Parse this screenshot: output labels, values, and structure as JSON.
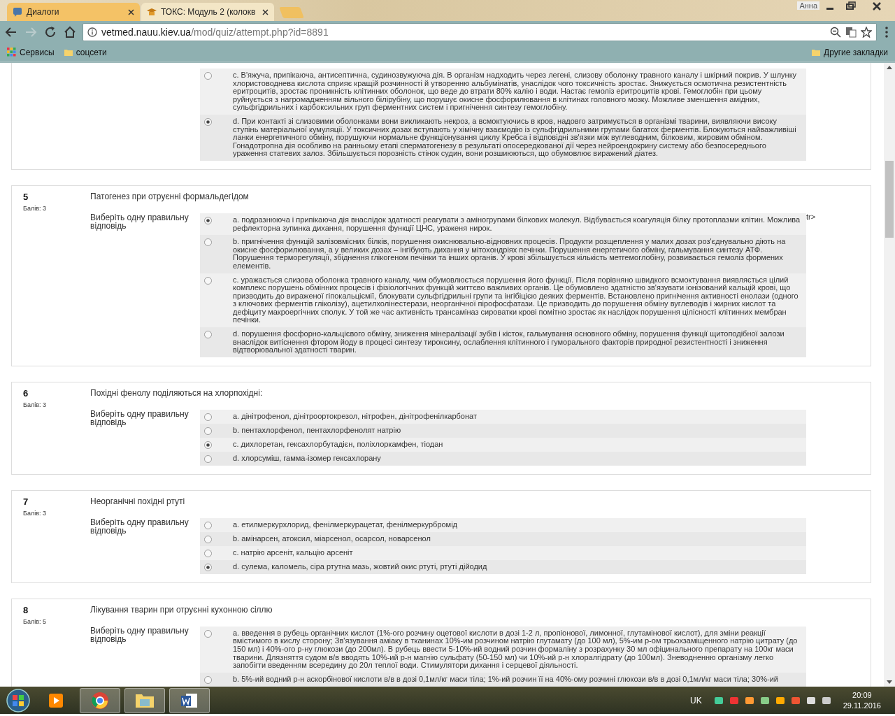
{
  "browser": {
    "tabs": [
      {
        "title": "Диалоги",
        "selected": false
      },
      {
        "title": "ТОКС: Модуль 2 (колокв",
        "selected": true
      }
    ],
    "profile": "Анна",
    "url_host": "vetmed.nauu.kiev.ua",
    "url_path": "/mod/quiz/attempt.php?id=8891",
    "bookmarks": [
      "Сервисы",
      "соцсети"
    ],
    "other_bookmarks": "Другие закладки"
  },
  "questions": [
    {
      "options": [
        {
          "text": "c. В'яжуча, припікаюча, антисептична, судинозвужуюча дія. В організм надходить через легені, слизову оболонку травного каналу і шкірний покрив. У шлунку хлористоводнева кислота сприяє кращій розчинності й утворенню альбумінатів, унаслідок чого токсичність зростає. Знижується осмотична резистентність еритроцитів, зростає проникність клітинних оболонок, що веде до втрати 80% калію і води. Настає гемоліз еритроцитів крові. Гемоглобін при цьому руйнується з нагромадженням вільного білірубіну, що порушує окисне фосфорилювання в клітинах головного мозку. Можливе зменшення амідних, сульфгідрильних і карбоксильних груп ферментних систем і пригнічення синтезу гемоглобіну.",
          "selected": false
        },
        {
          "text": "d. При контакті зі слизовими оболонками вони викликають некроз, а всмоктуючись в кров, надовго затримується в організмі тварини, виявляючи високу ступінь матеріальної кумуляції. У токсичних дозах вступають у хімічну взаємодію із сульфгідрильними групами багатох ферментів. Блокуються найважливіші ланки енергетичного обміну, порушуючи нормальне функціонування циклу Кребса і відповідні зв'язки між вуглеводним, білковим, жировим обміном. Гонадотропна дія особливо на ранньому етапі сперматогенезу в результаті опосередкованої дії через нейроендокрину систему або безпосереднього ураження статевих залоз. Збільшується порозність стінок судин, вони розшиюються, що обумовлює виражений діатез.",
          "selected": true
        }
      ]
    },
    {
      "number": "5",
      "grade": "Балів: 3",
      "text": "Патогенез при отруєнні формальдегідом",
      "prompt": "Виберіть одну правильну відповідь",
      "stray": "tr>",
      "options": [
        {
          "text": "a. подразнююча і припікаюча дія внаслідок здатності реагувати з аміногрупами білкових молекул. Відбувається коагуляція білку протоплазми клітин. Можлива рефлекторна зупинка дихання, порушення функції ЦНС, ураженя нирок.",
          "selected": true
        },
        {
          "text": "b. пригнічення функцій залізовмісних білків, порушення окиснювально-відновних процесів. Продукти розщеплення у малих дозах роз'єднувально діють на окисне фосфорилювання, а у великих дозах – інгібують дихання у мітохондріях печінки. Порушення енергетичого обміну, гальмування синтезу АТФ. Порушення терморегуляції, збіднення глікогеном печінки та інших органів. У крові збільшується кількість метгемоглобіну, розвивається гемоліз формених елементів.",
          "selected": false
        },
        {
          "text": "c. уражається слизова оболонка травного каналу, чим обумовлюється порушення його функції. Після порівняно швидкого всмоктування виявляється цілий комплекс порушень обмінних процесів і фізіологічних функцій життєво важливих органів. Це обумовлено здатністю зв'язувати іонізований кальцій крові, що призводить до вираженої гіпокальціємії, блокувати сульфгідрильні групи та інгібіцією деяких ферментів. Встановлено пригнічення активності енолази (одного з ключових ферментів гліколізу), ацетилхолінестерази, неорганічної пірофосфатази. Це призводить до порушення обміну вуглеводів і жирних кислот та дефіциту макроергічних сполук. У той же час активність трансаміназ сироватки крові помітно зростає як наслідок порушення цілісності клітинних мембран печінки.",
          "selected": false
        },
        {
          "text": "d. порушення фосфорно-кальцієвого обміну, зниження мінералізації зубів і кісток, гальмування основного обміну, порушення функції щитоподібної залози внаслідок витіснення фтором йоду в процесі синтезу тироксину, ослаблення клітинного і гуморального факторів природної резистентності і зниження відтворювальної здатності тварин.",
          "selected": false
        }
      ]
    },
    {
      "number": "6",
      "grade": "Балів: 3",
      "text": "Похідні фенолу поділяються на хлорпохідні:",
      "prompt": "Виберіть одну правильну відповідь",
      "options": [
        {
          "text": "a. дінітрофенол, дінітроортокрезол, нітрофен, дінітрофенілкарбонат",
          "selected": false
        },
        {
          "text": "b. пентахлорфенол, пентахлорфенолят натрію",
          "selected": false
        },
        {
          "text": "c. дихлоретан, гексахлорбутадієн, поліхлоркамфен, тіодан",
          "selected": true
        },
        {
          "text": "d. хлорсуміш, гамма-ізомер гексахлорану",
          "selected": false
        }
      ]
    },
    {
      "number": "7",
      "grade": "Балів: 3",
      "text": "Неорганічні похідні ртуті",
      "prompt": "Виберіть одну правильну відповідь",
      "options": [
        {
          "text": "a. етилмеркурхлорид, фенілмеркурацетат, фенілмеркурбромід",
          "selected": false
        },
        {
          "text": "b. амінарсен, атоксил, міарсенол, осарсол, новарсенол",
          "selected": false
        },
        {
          "text": "c. натрію арсеніт, кальцію арсеніт",
          "selected": false
        },
        {
          "text": "d. сулема, каломель, сіра ртутна мазь, жовтий окис ртуті, ртуті дійодид",
          "selected": true
        }
      ]
    },
    {
      "number": "8",
      "grade": "Балів: 5",
      "text": "Лікування тварин при отруєнні кухонною сіллю",
      "prompt": "Виберіть одну правильну відповідь",
      "options": [
        {
          "text": "a. введення в рубець органічних кислот (1%-ого розчину оцетової кислоти в дозі 1-2 л, пропіонової, лимонної, глутамінової кислот), для зміни реакції вмістимого в кислу сторону; Зв'язування аміаку в тканинах 10%-им розчином натрію глутамату (до 100 мл), 5%-им р-ом трьохзаміщенного натрію цитрату (до 150 мл) і 40%-ого р-ну глюкози (до 200мл). В рубець ввести 5-10%-ий водний розчин формаліну з розрахунку 30 мл офіцинального препарату на 100кг маси тварини. Длязняття судом в/в вводять 10%-ий р-н магнію сульфату (50-150 мл) чи 10%-ий р-н хлоралгідрату (до 100мл). Зневодненню організму легко запобігти введенням всередину до 20л теплої води. Стимулятори дихання і серцевої діяльності.",
          "selected": false
        },
        {
          "text": "b. 5%-ий водний р-н аскорбінової кислоти в/в в дозі 0,1мл/кг маси тіла; 1%-ий розчин її на 40%-ому розчині глюкози в/в в дозі 0,1мл/кг маси тіла; 30%-ий",
          "selected": false
        }
      ]
    }
  ],
  "taskbar": {
    "language": "UK",
    "time": "20:09",
    "date": "29.11.2016"
  }
}
